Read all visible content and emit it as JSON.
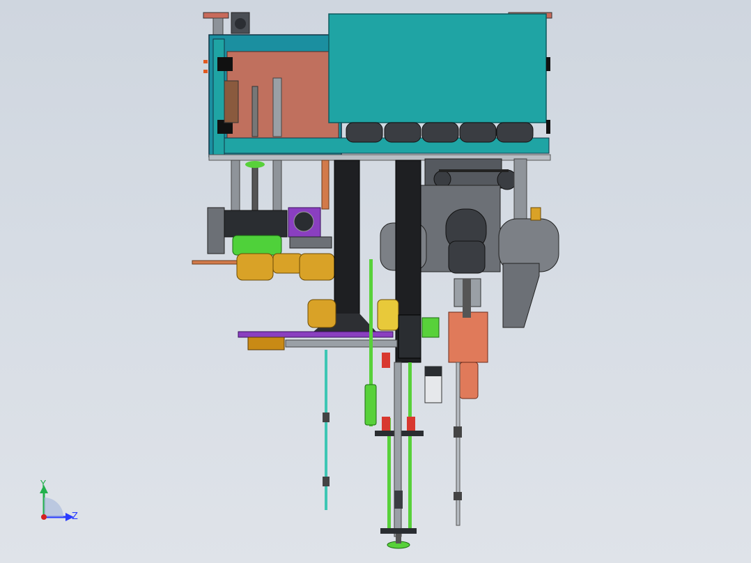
{
  "viewport": {
    "background_top": "#cfd6df",
    "background_bottom": "#dfe3e9"
  },
  "colors": {
    "teal_housing": "#1fa4a4",
    "teal_frame": "#1b8fa0",
    "copper_panel": "#c0705e",
    "yellow_part": "#d9a227",
    "green_rod": "#58d13a",
    "purple_plate": "#8a3fc0",
    "dark_column": "#222222",
    "red_part": "#d8382f",
    "salmon_part": "#e07a5a",
    "gray_metal": "#7c8086"
  },
  "triad": {
    "y_label": "Y",
    "z_label": "Z",
    "y_color": "#22b14c",
    "z_color": "#2a3cff",
    "x_color": "#d42020"
  },
  "component_icons": [
    "teal-housing-icon",
    "copper-back-panel-icon",
    "motor-icon",
    "cooling-fan-icon",
    "black-column-icon",
    "pressure-tank-icon",
    "spring-rod-icon",
    "yellow-cup-icon",
    "slide-rail-icon",
    "foot-plate-icon"
  ]
}
